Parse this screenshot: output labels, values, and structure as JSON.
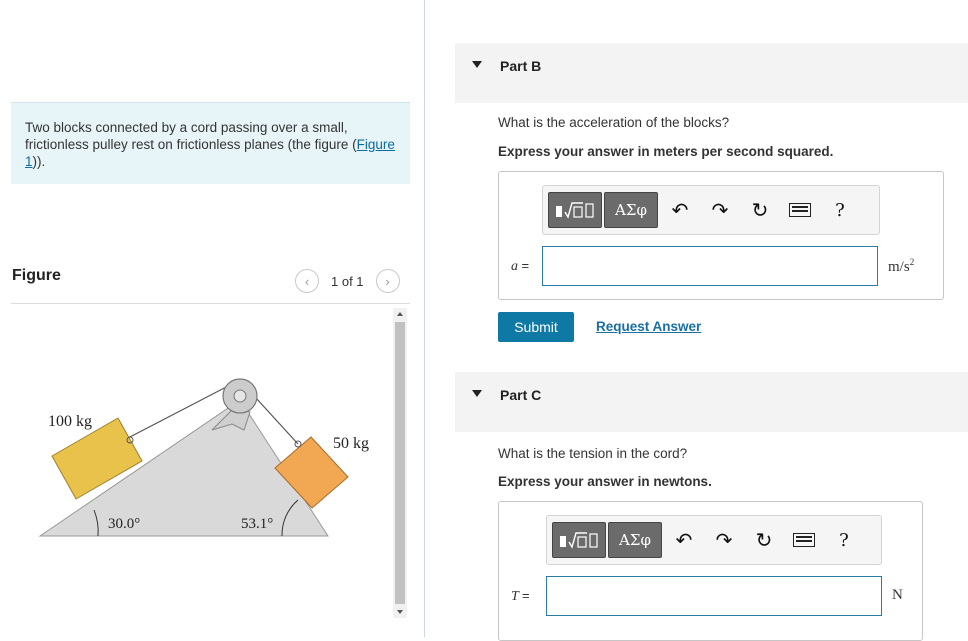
{
  "problem": {
    "text_before_link": "Two blocks connected by a cord passing over a small, frictionless pulley rest on frictionless planes (the figure (",
    "link_text": "Figure 1",
    "text_after_link": "))."
  },
  "figure": {
    "title": "Figure",
    "page_indicator": "1 of 1",
    "mass_left": "100 kg",
    "mass_right": "50 kg",
    "angle_left": "30.0°",
    "angle_right": "53.1°",
    "colors": {
      "block_left": "#e9c24b",
      "block_right": "#f2a752",
      "incline": "#d9d9d9"
    }
  },
  "part_b": {
    "title": "Part B",
    "question": "What is the acceleration of the blocks?",
    "instruction": "Express your answer in meters per second squared.",
    "variable": "a",
    "equals": "=",
    "unit_base": "m/s",
    "unit_exp": "2",
    "input_value": "",
    "greek_label": "ΑΣφ",
    "help": "?",
    "submit_label": "Submit",
    "request_label": "Request Answer"
  },
  "part_c": {
    "title": "Part C",
    "question": "What is the tension in the cord?",
    "instruction": "Express your answer in newtons.",
    "variable": "T",
    "equals": "=",
    "unit": "N",
    "input_value": "",
    "greek_label": "ΑΣφ",
    "help": "?"
  },
  "colors": {
    "accent": "#0f79a6",
    "link": "#1a6fa5",
    "header_bg": "#f3f3f3",
    "problem_bg": "#e8f5f8"
  }
}
